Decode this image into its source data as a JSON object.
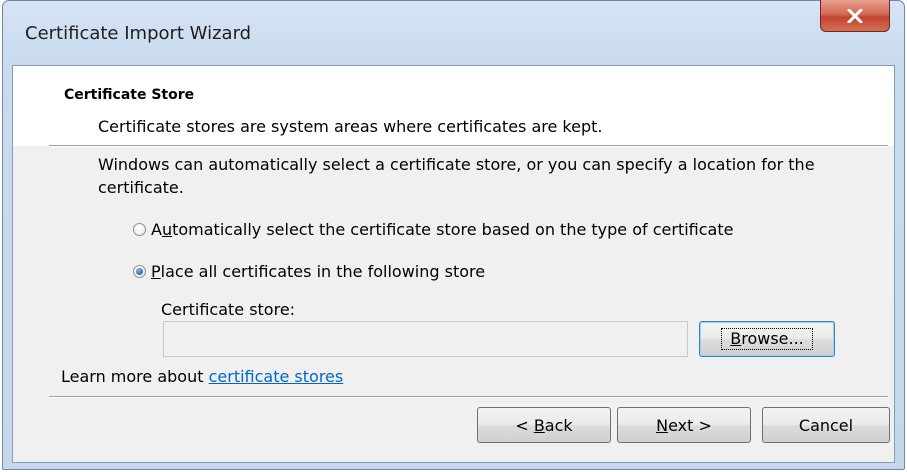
{
  "window": {
    "title": "Certificate Import Wizard"
  },
  "header": {
    "title": "Certificate Store",
    "description": "Certificate stores are system areas where certificates are kept."
  },
  "body": {
    "intro": "Windows can automatically select a certificate store, or you can specify a location for the certificate.",
    "radio_auto": {
      "prefix": "A",
      "mnemonic": "u",
      "rest": "tomatically select the certificate store based on the type of certificate",
      "checked": false
    },
    "radio_place": {
      "mnemonic": "P",
      "rest": "lace all certificates in the following store",
      "checked": true
    },
    "store_label": "Certificate store:",
    "store_value": "",
    "browse": {
      "mnemonic": "B",
      "rest": "rowse..."
    },
    "learn_more_prefix": "Learn more about ",
    "learn_more_link": "certificate stores"
  },
  "footer": {
    "back": {
      "prefix": "< ",
      "mnemonic": "B",
      "rest": "ack"
    },
    "next": {
      "mnemonic": "N",
      "rest": "ext >"
    },
    "cancel": "Cancel"
  },
  "colors": {
    "close_button": "#c2452f",
    "link": "#0066cc",
    "dialog_background": "#f0f0f0"
  },
  "icons": {
    "close": "close-icon"
  }
}
